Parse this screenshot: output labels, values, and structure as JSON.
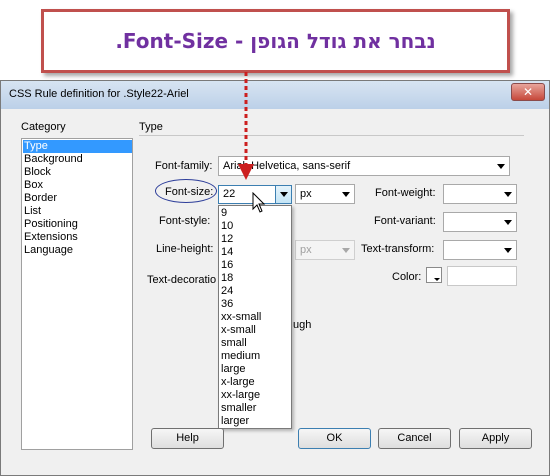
{
  "annotation": {
    "text": "נבחר את גודל הגופן - Font-Size."
  },
  "dialog": {
    "title": "CSS Rule definition for .Style22-Ariel"
  },
  "category": {
    "label": "Category",
    "items": [
      "Type",
      "Background",
      "Block",
      "Box",
      "Border",
      "List",
      "Positioning",
      "Extensions",
      "Language"
    ],
    "selected": "Type"
  },
  "type_panel": {
    "heading": "Type",
    "font_family": {
      "label": "Font-family:",
      "value": "Arial, Helvetica, sans-serif"
    },
    "font_size": {
      "label": "Font-size:",
      "value": "22",
      "unit": "px",
      "options": [
        "9",
        "10",
        "12",
        "14",
        "16",
        "18",
        "24",
        "36",
        "xx-small",
        "x-small",
        "small",
        "medium",
        "large",
        "x-large",
        "xx-large",
        "smaller",
        "larger"
      ]
    },
    "font_weight": {
      "label": "Font-weight:",
      "value": ""
    },
    "font_style": {
      "label": "Font-style:",
      "value": ""
    },
    "font_variant": {
      "label": "Font-variant:",
      "value": ""
    },
    "line_height": {
      "label": "Line-height:",
      "value": "",
      "unit": "px"
    },
    "text_transform": {
      "label": "Text-transform:",
      "value": ""
    },
    "text_decoration": {
      "label": "Text-decoratio",
      "fragment": "ugh"
    },
    "color": {
      "label": "Color:",
      "value": ""
    }
  },
  "buttons": {
    "help": "Help",
    "ok": "OK",
    "cancel": "Cancel",
    "apply": "Apply"
  },
  "colors": {
    "selection": "#3399ff",
    "banner_border": "#c0504d",
    "banner_text": "#7030a0",
    "arrow": "#cc1f1f",
    "ellipse": "#2d3e9a"
  }
}
